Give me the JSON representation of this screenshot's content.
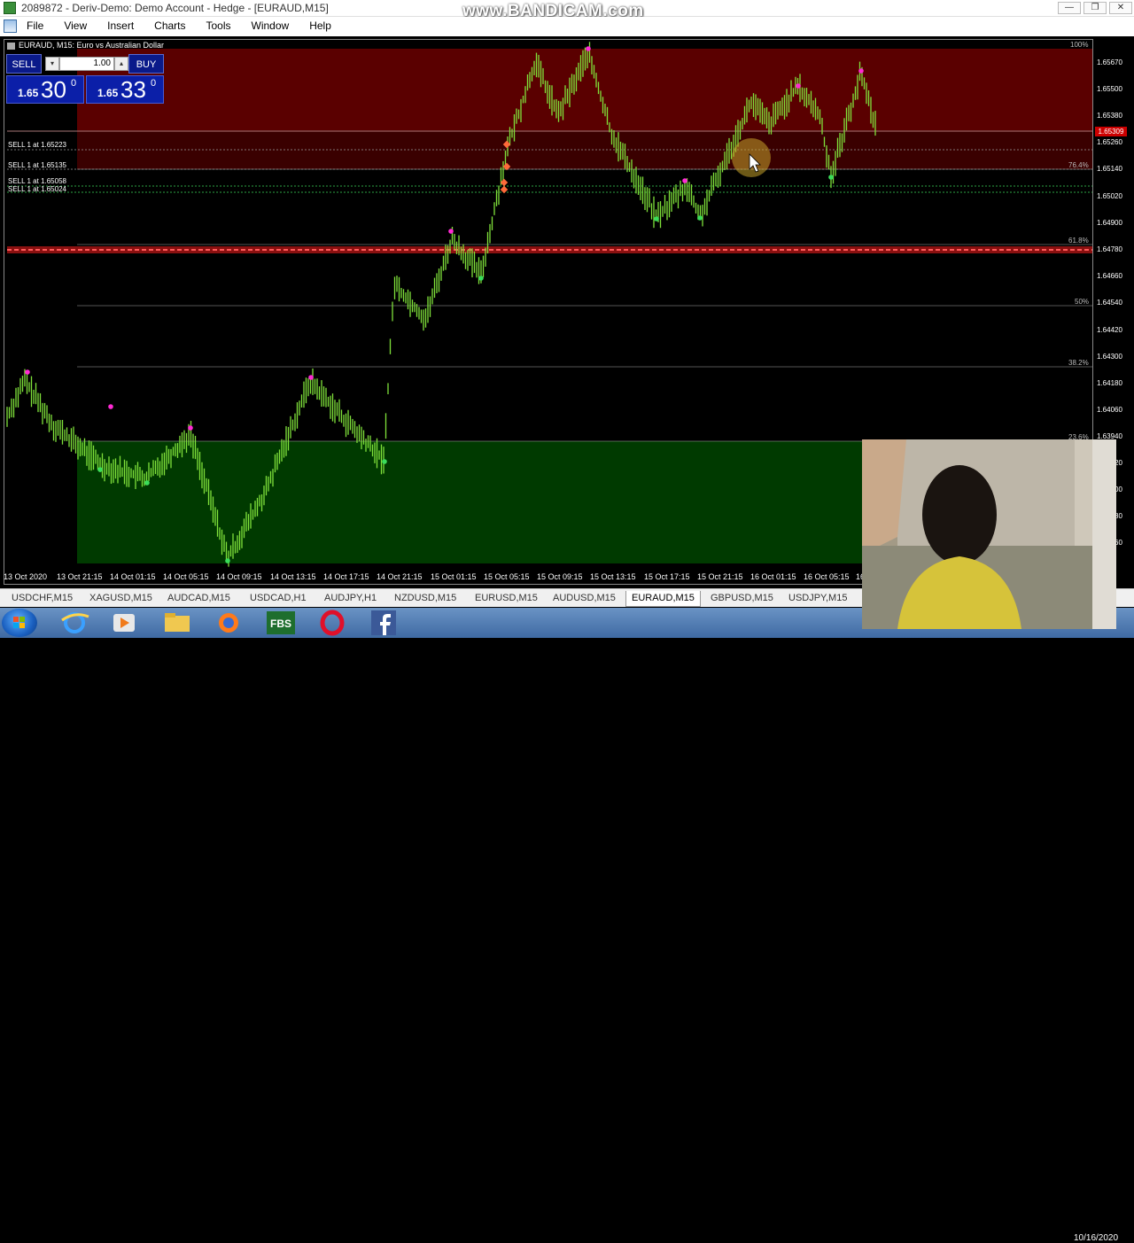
{
  "window": {
    "title": "2089872 - Deriv-Demo: Demo Account - Hedge - [EURAUD,M15]",
    "watermark": "www.BANDICAM.com",
    "controls": [
      "—",
      "❐",
      "✕"
    ]
  },
  "menu": [
    "File",
    "View",
    "Insert",
    "Charts",
    "Tools",
    "Window",
    "Help"
  ],
  "chart": {
    "header": "EURAUD, M15: Euro vs Australian Dollar",
    "top_pct": "100%"
  },
  "trade_panel": {
    "sell_label": "SELL",
    "buy_label": "BUY",
    "lot": "1.00",
    "lot_down": "▾",
    "lot_up": "▴",
    "sell": {
      "small": "1.65",
      "big": "30",
      "sup": "0"
    },
    "buy": {
      "small": "1.65",
      "big": "33",
      "sup": "0"
    }
  },
  "orders": [
    "SELL 1 at 1.65223",
    "SELL 1 at 1.65135",
    "SELL 1 at 1.65058",
    "SELL 1 at 1.65024"
  ],
  "fib_levels": [
    "76.4%",
    "61.8%",
    "50%",
    "38.2%",
    "23.6%"
  ],
  "price_scale": [
    "1.65670",
    "1.65500",
    "1.65380",
    "1.65260",
    "1.65140",
    "1.65020",
    "1.64900",
    "1.64780",
    "1.64660",
    "1.64540",
    "1.64420",
    "1.64300",
    "1.64180",
    "1.64060",
    "1.63940",
    "1.63820",
    "1.63700",
    "1.63580",
    "1.63460"
  ],
  "current_price": "1.65309",
  "time_axis": [
    "13 Oct 2020",
    "13 Oct 21:15",
    "14 Oct 01:15",
    "14 Oct 05:15",
    "14 Oct 09:15",
    "14 Oct 13:15",
    "14 Oct 17:15",
    "14 Oct 21:15",
    "15 Oct 01:15",
    "15 Oct 05:15",
    "15 Oct 09:15",
    "15 Oct 13:15",
    "15 Oct 17:15",
    "15 Oct 21:15",
    "16 Oct 01:15",
    "16 Oct 05:15",
    "16"
  ],
  "tabs": [
    "USDCHF,M15",
    "XAGUSD,M15",
    "AUDCAD,M15",
    "USDCAD,H1",
    "AUDJPY,H1",
    "NZDUSD,M15",
    "EURUSD,M15",
    "AUDUSD,M15",
    "EURAUD,M15",
    "GBPUSD,M15",
    "USDJPY,M15"
  ],
  "active_tab": "EURAUD,M15",
  "taskbar": {
    "fbs_label": "FBS",
    "clock": "10/16/2020"
  },
  "colors": {
    "candle": "#7fe03a",
    "upper_zone": "#5a0000",
    "lower_zone": "#003a00",
    "marker_high": "#ff2ad4",
    "marker_low": "#3adc5a",
    "sell_button": "#0a1a8a"
  }
}
